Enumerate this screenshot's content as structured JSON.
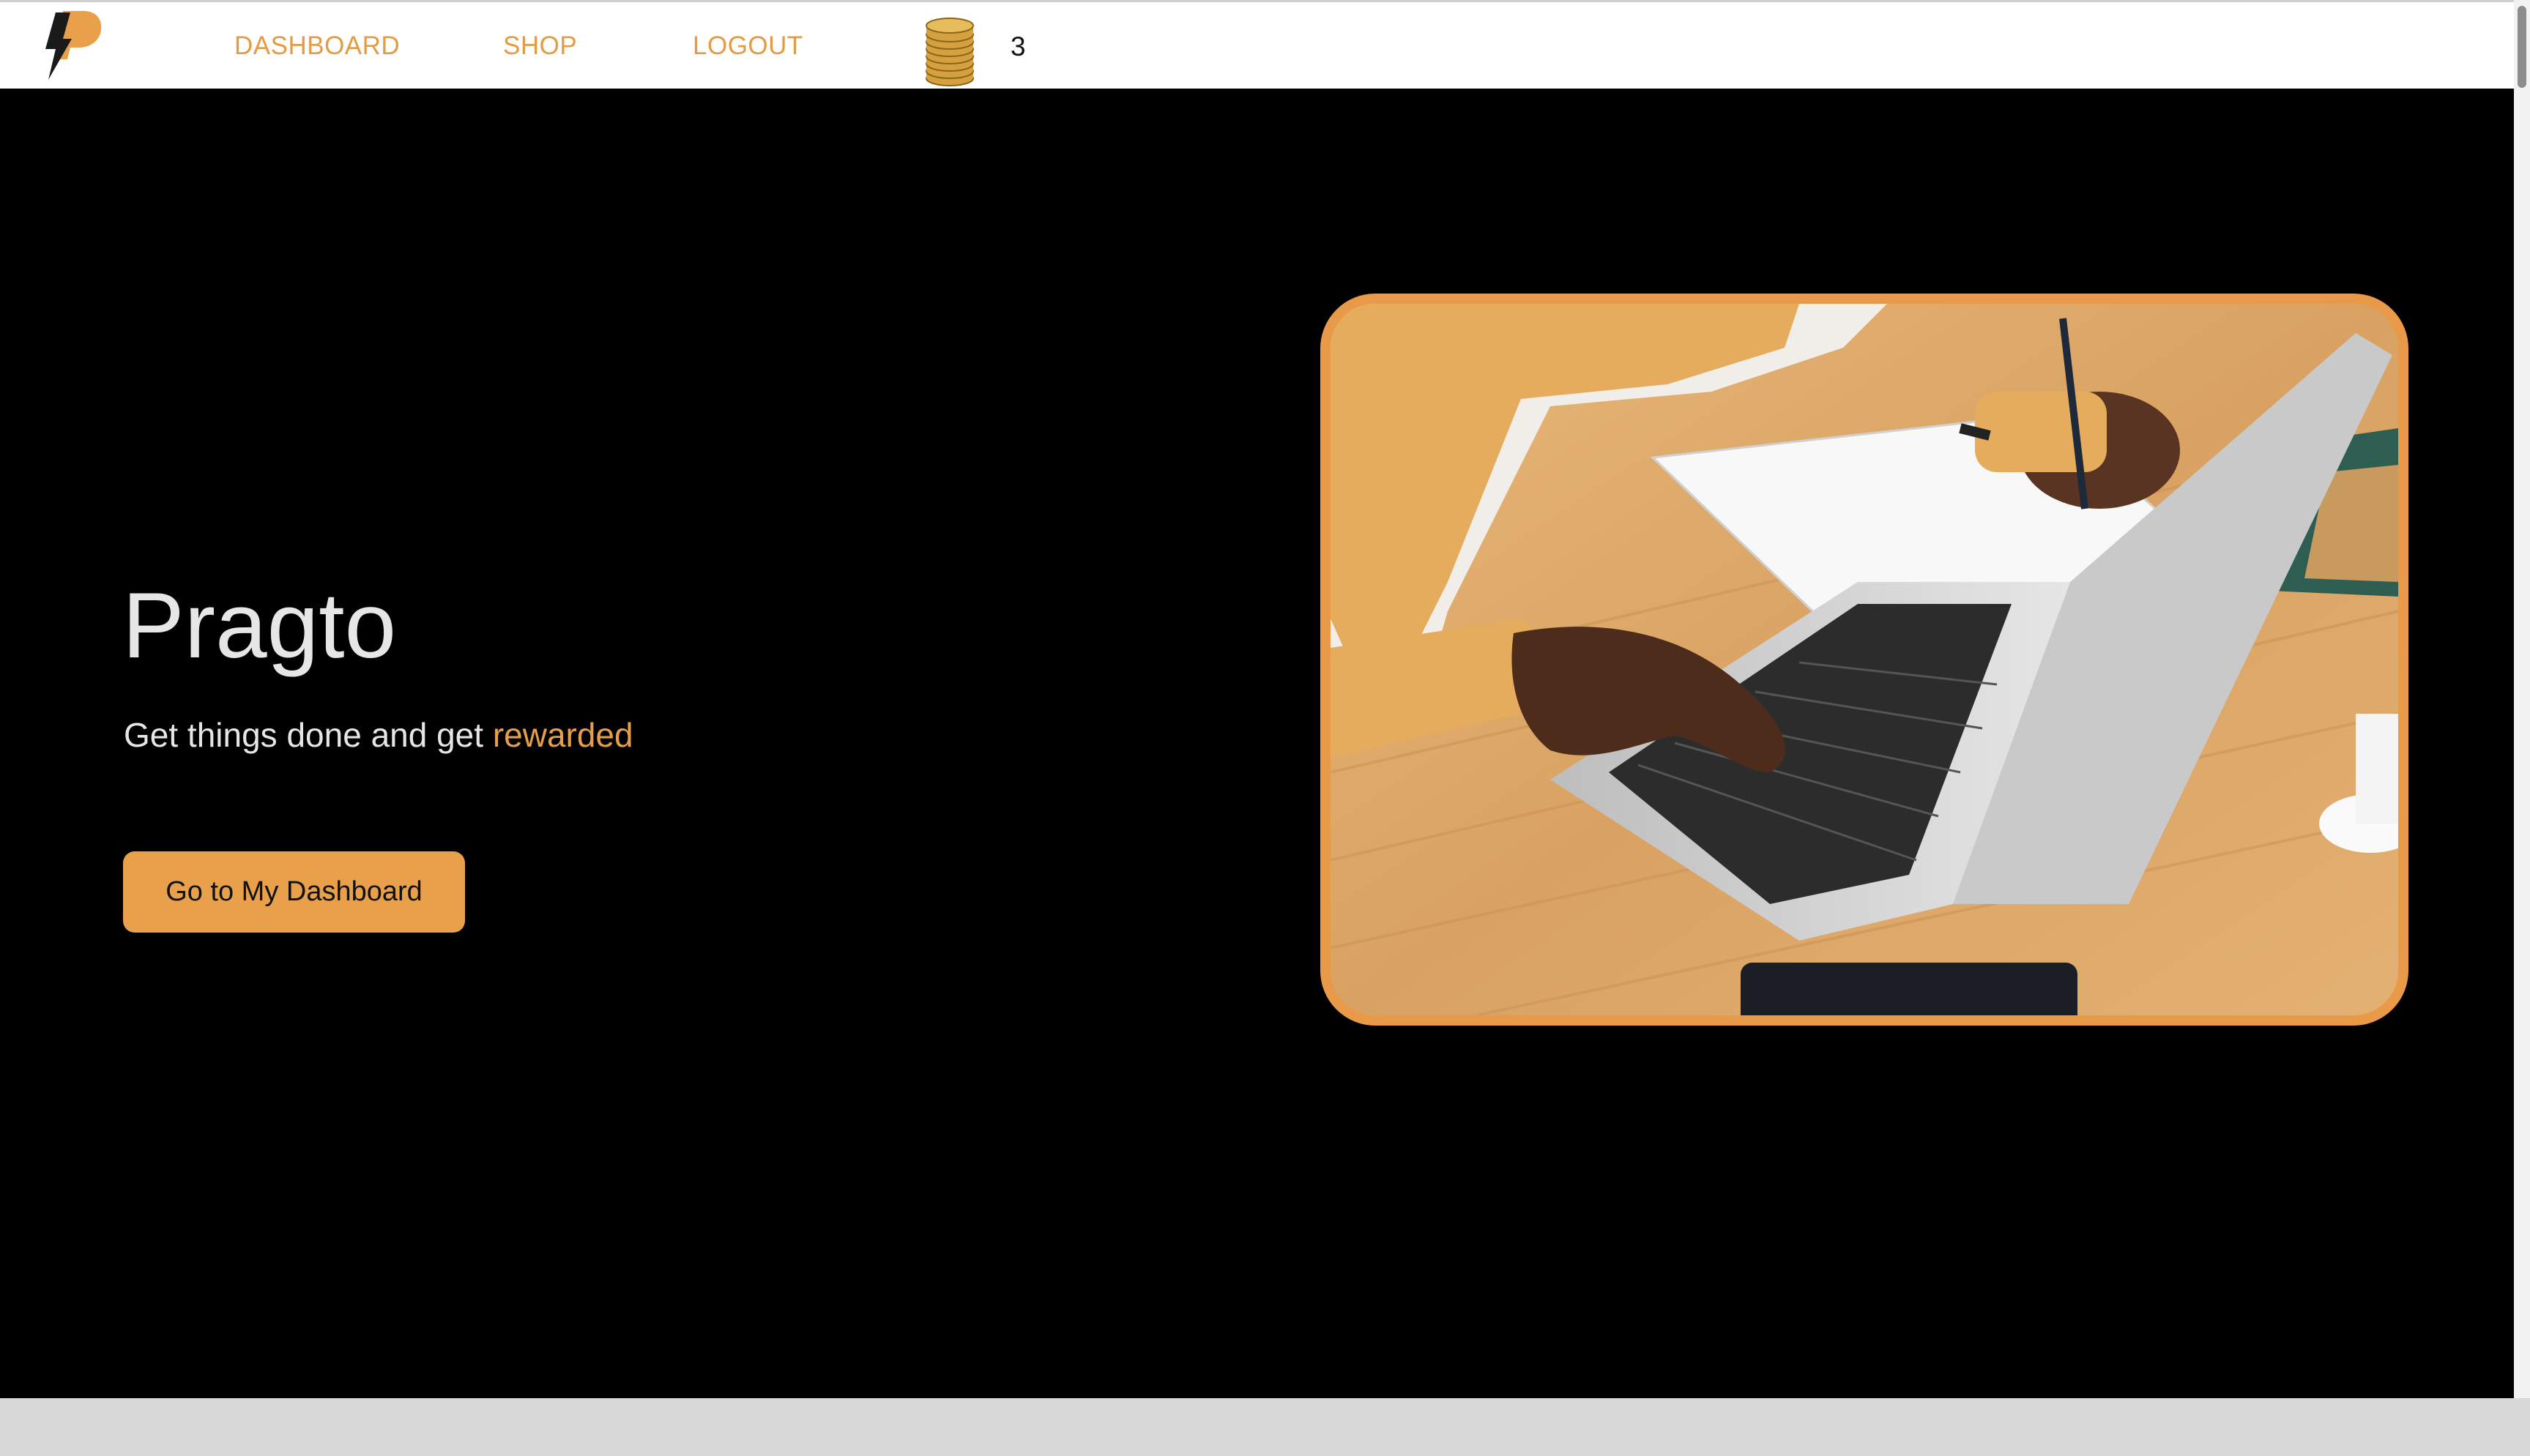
{
  "nav": {
    "logo_icon": "pragto-logo-icon",
    "links": [
      "DASHBOARD",
      "SHOP",
      "LOGOUT"
    ],
    "coins_icon": "coin-stack-icon",
    "coin_count": "3"
  },
  "hero": {
    "title": "Pragto",
    "subtitle_prefix": "Get things done and get ",
    "subtitle_accent": "rewarded",
    "cta_label": "Go to My Dashboard",
    "image_icon": "laptop-hands-photo"
  },
  "colors": {
    "accent": "#e8a04b",
    "background": "#000000",
    "nav_background": "#ffffff",
    "text_light": "#e6e6e6"
  }
}
